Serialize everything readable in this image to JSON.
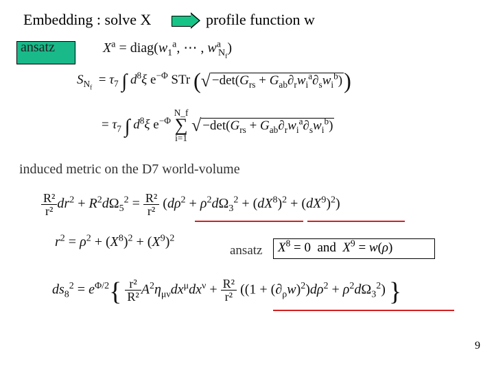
{
  "header": {
    "left": "Embedding :  solve X",
    "right": "profile function w"
  },
  "ansatz_label": "ansatz",
  "eq_X": "Xᵃ = diag(w₁ᵃ, ⋯ , wᵃ_{N_f})",
  "eq_S": {
    "lhs": "S_{N_f}",
    "line1_pre": "= τ₇ ",
    "line1_int": "∫ d⁸ξ e⁻Φ STr",
    "line1_body": "−det(G_{rs} + G_{ab}∂_r w_iᵃ ∂_s w_iᵇ)",
    "line2_pre": "= τ₇ ",
    "line2_int": "∫ d⁸ξ e⁻Φ",
    "line2_body": "−det(G_{rs} + G_{ab}∂_r w_iᵃ ∂_s w_iᵇ)",
    "sum_top": "N_f",
    "sum_bot": "i=1"
  },
  "induced_label": "induced metric on the D7 world-volume",
  "eq_metric1": {
    "lhs_top": "R²",
    "lhs_bot": "r²",
    "lhs_rest": " dr² + R² dΩ₅² = ",
    "rhs_top": "R²",
    "rhs_bot": "r²",
    "rhs_body": "(dρ² + ρ² dΩ₃² + (dX⁸)² + (dX⁹)²)"
  },
  "eq_r2": "r² = ρ² + (X⁸)² + (X⁹)²",
  "ansatz2_label": "ansatz",
  "boxed_eq": "X⁸ = 0  and  X⁹ = w(ρ)",
  "eq_ds": {
    "lhs": "ds₈² = eΦ/2",
    "term1_top": "r²",
    "term1_bot": "R²",
    "term1_rest": "A² η_{μν} dxμ dxν + ",
    "term2_top": "R²",
    "term2_bot": "r²",
    "term2_body": "((1 + (∂_ρ w)²) dρ² + ρ² dΩ₃²)"
  },
  "page": "9"
}
